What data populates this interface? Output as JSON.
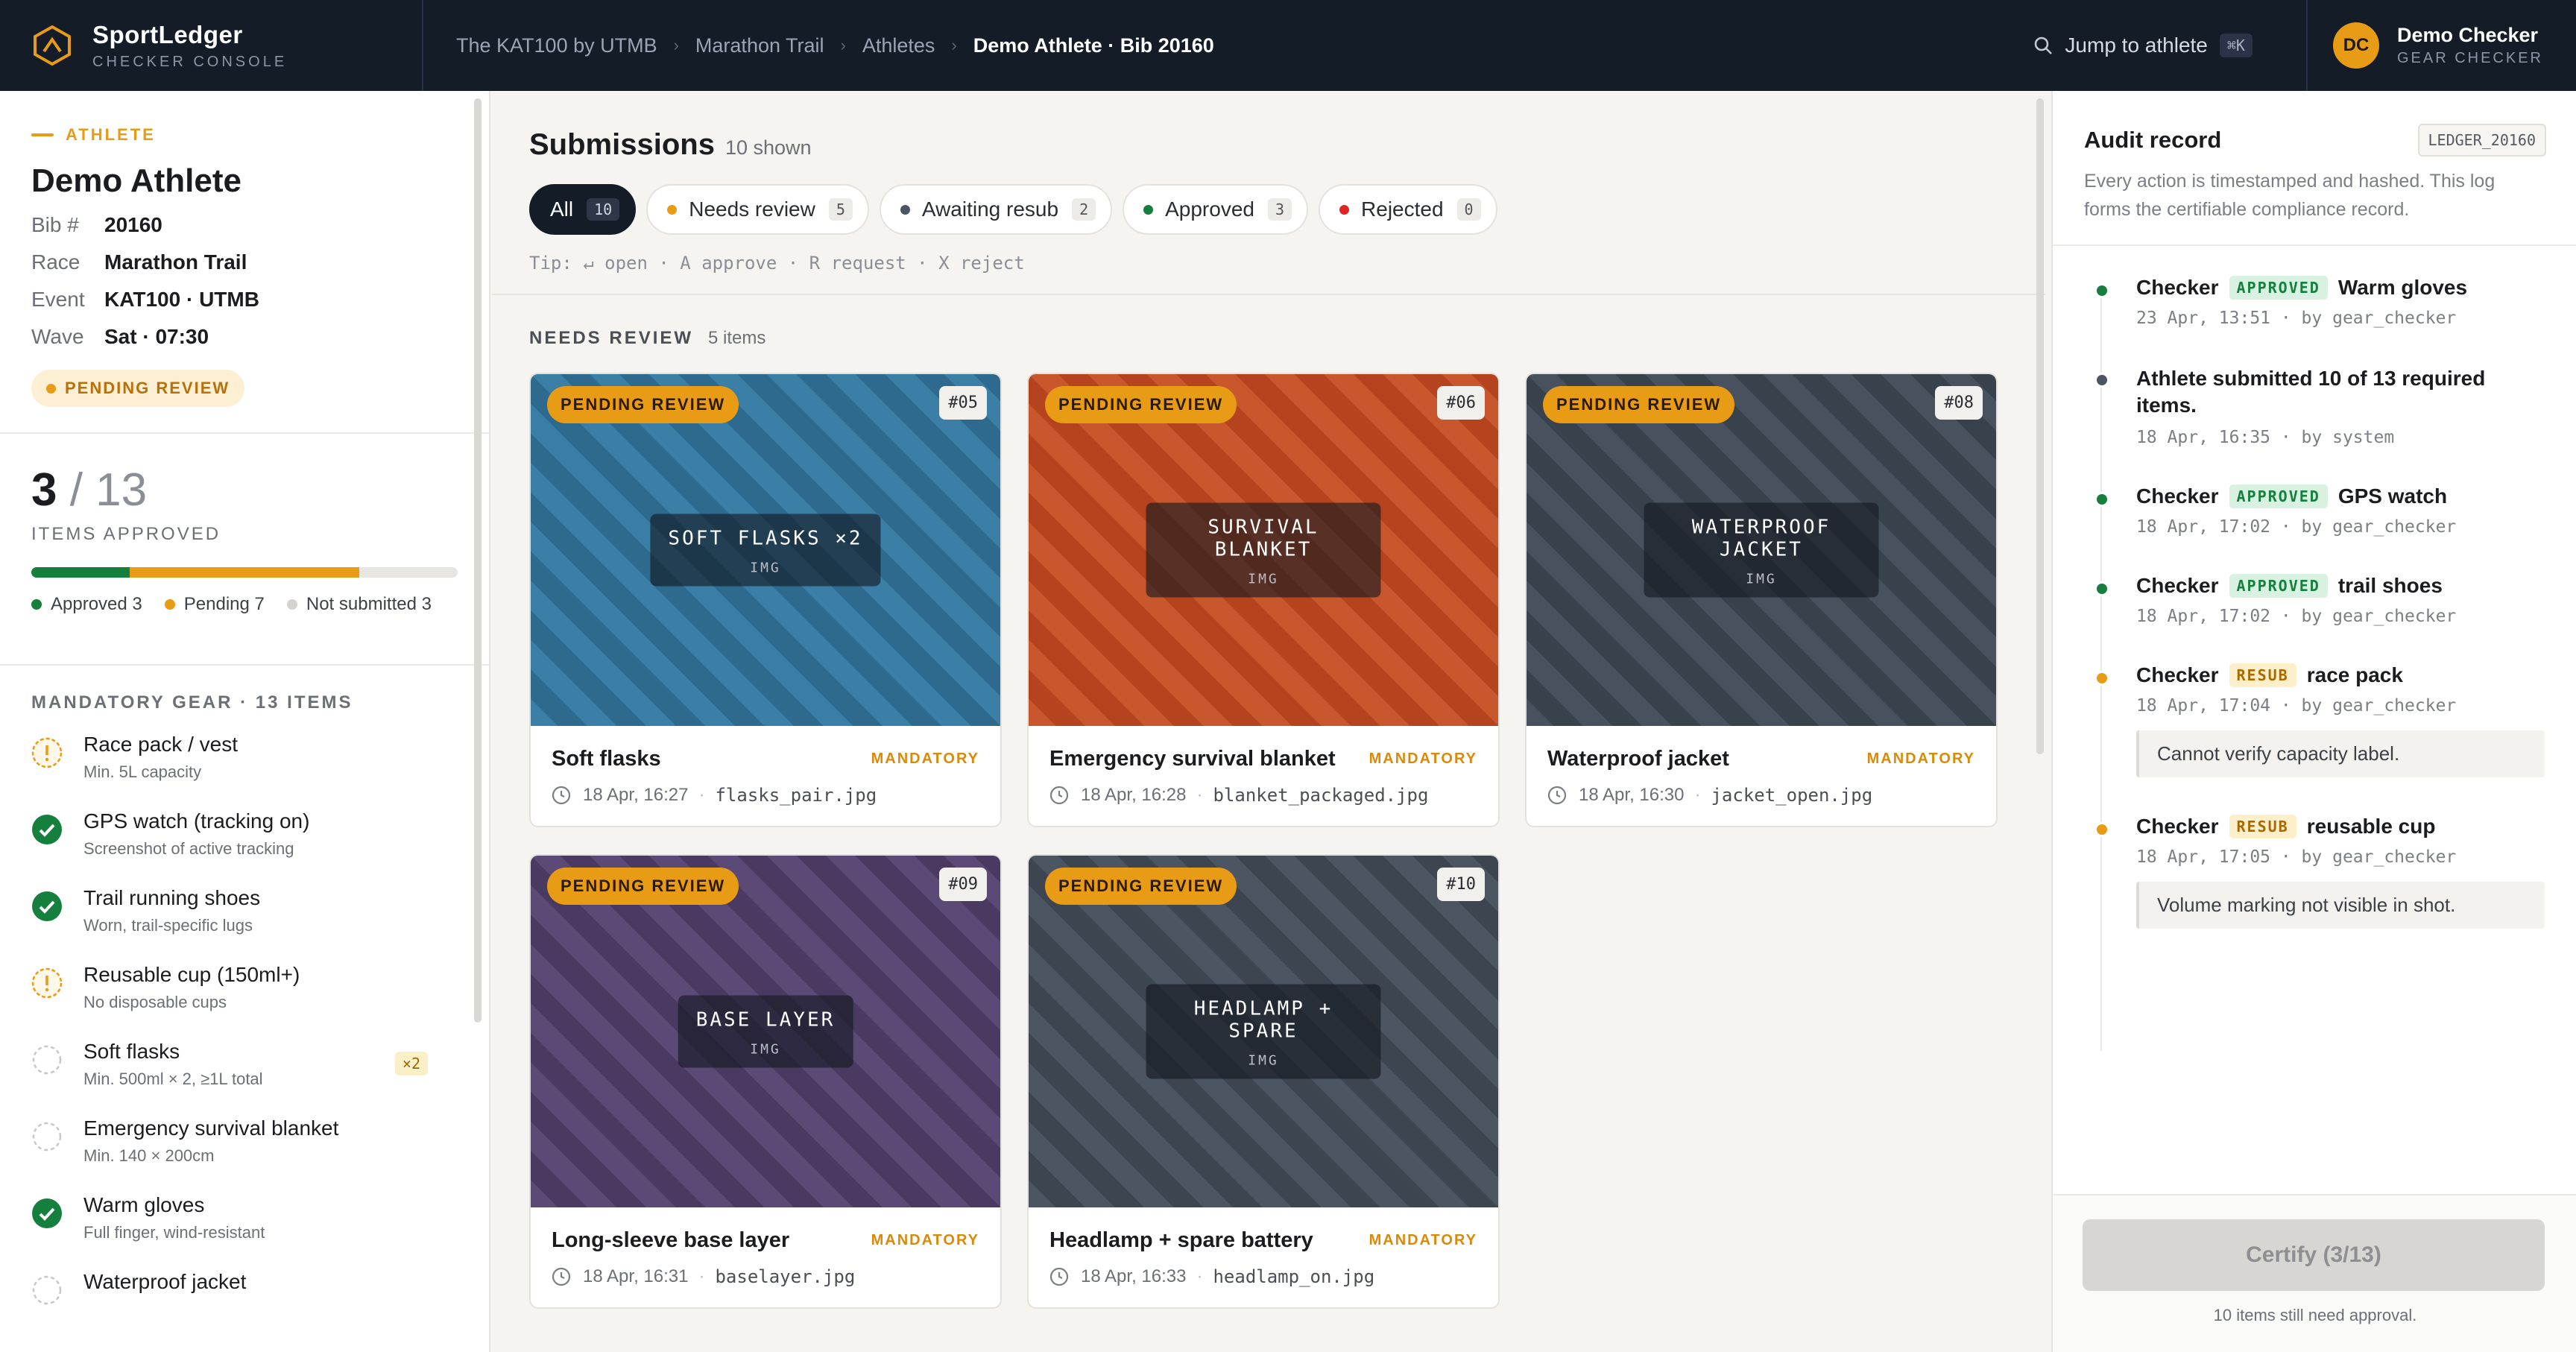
{
  "brand": {
    "name": "SportLedger",
    "sub": "CHECKER CONSOLE"
  },
  "breadcrumb": [
    "The KAT100 by UTMB",
    "Marathon Trail",
    "Athletes",
    "Demo Athlete · Bib 20160"
  ],
  "search": {
    "label": "Jump to athlete",
    "kbd": "⌘K"
  },
  "user": {
    "initials": "DC",
    "name": "Demo Checker",
    "role": "GEAR CHECKER"
  },
  "athlete": {
    "section": "ATHLETE",
    "name": "Demo Athlete",
    "fields": [
      {
        "k": "Bib #",
        "v": "20160"
      },
      {
        "k": "Race",
        "v": "Marathon Trail"
      },
      {
        "k": "Event",
        "v": "KAT100 · UTMB"
      },
      {
        "k": "Wave",
        "v": "Sat · 07:30"
      }
    ],
    "status": "PENDING REVIEW"
  },
  "progress": {
    "approved": "3",
    "total": "/ 13",
    "label": "ITEMS APPROVED",
    "approved_frac": 0.2308,
    "pending_frac": 0.5385,
    "legend": [
      {
        "label": "Approved 3",
        "color": "#15803d"
      },
      {
        "label": "Pending 7",
        "color": "#e89b15"
      },
      {
        "label": "Not submitted 3",
        "color": "#d4d3cf"
      }
    ]
  },
  "gear": {
    "title": "MANDATORY GEAR · 13 ITEMS",
    "items": [
      {
        "name": "Race pack / vest",
        "sub": "Min. 5L capacity",
        "status": "warn"
      },
      {
        "name": "GPS watch (tracking on)",
        "sub": "Screenshot of active tracking",
        "status": "ok"
      },
      {
        "name": "Trail running shoes",
        "sub": "Worn, trail-specific lugs",
        "status": "ok"
      },
      {
        "name": "Reusable cup (150ml+)",
        "sub": "No disposable cups",
        "status": "warn"
      },
      {
        "name": "Soft flasks",
        "sub": "Min. 500ml × 2, ≥1L total",
        "status": "pending",
        "badge": "×2"
      },
      {
        "name": "Emergency survival blanket",
        "sub": "Min. 140 × 200cm",
        "status": "pending"
      },
      {
        "name": "Warm gloves",
        "sub": "Full finger, wind-resistant",
        "status": "ok"
      },
      {
        "name": "Waterproof jacket",
        "sub": "",
        "status": "pending"
      }
    ]
  },
  "submissions": {
    "title": "Submissions",
    "count": "10 shown",
    "filters": [
      {
        "label": "All",
        "count": "10",
        "active": true,
        "color": ""
      },
      {
        "label": "Needs review",
        "count": "5",
        "color": "#e89b15"
      },
      {
        "label": "Awaiting resub",
        "count": "2",
        "color": "#4b5563"
      },
      {
        "label": "Approved",
        "count": "3",
        "color": "#15803d"
      },
      {
        "label": "Rejected",
        "count": "0",
        "color": "#dc2626"
      }
    ],
    "tip": "Tip: ↵ open · A approve · R request · X reject",
    "section": "NEEDS REVIEW",
    "section_count": "5 items"
  },
  "cards": [
    {
      "badge": "PENDING REVIEW",
      "num": "#05",
      "img_label": "SOFT FLASKS ×2",
      "img_sub": "IMG",
      "name": "Soft flasks",
      "tag": "MANDATORY",
      "time": "18 Apr, 16:27",
      "file": "flasks_pair.jpg",
      "bg": "#2e6a8e",
      "stripe": "#3b7ea6"
    },
    {
      "badge": "PENDING REVIEW",
      "num": "#06",
      "img_label": "SURVIVAL BLANKET",
      "img_sub": "IMG",
      "name": "Emergency survival blanket",
      "tag": "MANDATORY",
      "time": "18 Apr, 16:28",
      "file": "blanket_packaged.jpg",
      "bg": "#b5441e",
      "stripe": "#c9572e"
    },
    {
      "badge": "PENDING REVIEW",
      "num": "#08",
      "img_label": "WATERPROOF JACKET",
      "img_sub": "IMG",
      "name": "Waterproof jacket",
      "tag": "MANDATORY",
      "time": "18 Apr, 16:30",
      "file": "jacket_open.jpg",
      "bg": "#38424d",
      "stripe": "#47525e"
    },
    {
      "badge": "PENDING REVIEW",
      "num": "#09",
      "img_label": "BASE LAYER",
      "img_sub": "IMG",
      "name": "Long-sleeve base layer",
      "tag": "MANDATORY",
      "time": "18 Apr, 16:31",
      "file": "baselayer.jpg",
      "bg": "#4a3a62",
      "stripe": "#5b4976"
    },
    {
      "badge": "PENDING REVIEW",
      "num": "#10",
      "img_label": "HEADLAMP + SPARE",
      "img_sub": "IMG",
      "name": "Headlamp + spare battery",
      "tag": "MANDATORY",
      "time": "18 Apr, 16:33",
      "file": "headlamp_on.jpg",
      "bg": "#3c4550",
      "stripe": "#4c5662"
    }
  ],
  "audit": {
    "title": "Audit record",
    "ledger": "LEDGER_20160",
    "desc": "Every action is timestamped and hashed. This log forms the certifiable compliance record.",
    "events": [
      {
        "actor": "Checker",
        "tag": "APPROVED",
        "item": "Warm gloves",
        "meta": "23 Apr, 13:51 · by gear_checker",
        "color": "#15803d",
        "type": "appr"
      },
      {
        "plain": "Athlete submitted 10 of 13 required items.",
        "meta": "18 Apr, 16:35 · by system",
        "color": "#4b5563"
      },
      {
        "actor": "Checker",
        "tag": "APPROVED",
        "item": "GPS watch",
        "meta": "18 Apr, 17:02 · by gear_checker",
        "color": "#15803d",
        "type": "appr"
      },
      {
        "actor": "Checker",
        "tag": "APPROVED",
        "item": "trail shoes",
        "meta": "18 Apr, 17:02 · by gear_checker",
        "color": "#15803d",
        "type": "appr"
      },
      {
        "actor": "Checker",
        "tag": "RESUB",
        "item": "race pack",
        "meta": "18 Apr, 17:04 · by gear_checker",
        "note": "Cannot verify capacity label.",
        "color": "#e89b15",
        "type": "resub"
      },
      {
        "actor": "Checker",
        "tag": "RESUB",
        "item": "reusable cup",
        "meta": "18 Apr, 17:05 · by gear_checker",
        "note": "Volume marking not visible in shot.",
        "color": "#e89b15",
        "type": "resub"
      }
    ],
    "certify": "Certify (3/13)",
    "footnote": "10 items still need approval."
  }
}
